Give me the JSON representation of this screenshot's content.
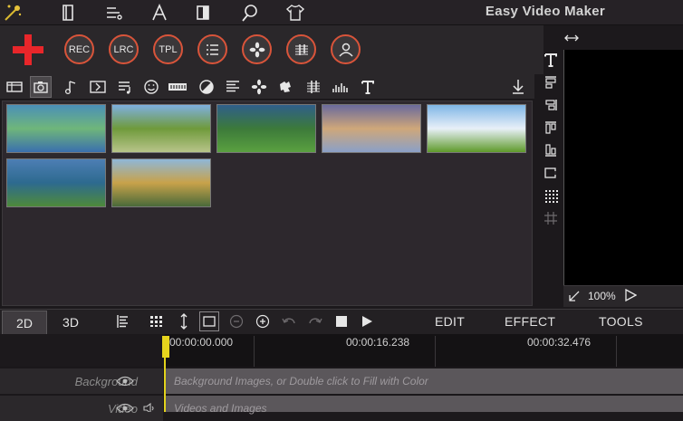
{
  "app": {
    "title": "Easy Video Maker"
  },
  "top_menu": {
    "icons": [
      "magic-wand-icon",
      "book-icon",
      "list-settings-icon",
      "text-tool-icon",
      "split-icon",
      "search-icon",
      "shirt-icon"
    ]
  },
  "toolbar": {
    "add_label": "+",
    "buttons": [
      {
        "id": "rec",
        "label": "REC"
      },
      {
        "id": "lrc",
        "label": "LRC"
      },
      {
        "id": "tpl",
        "label": "TPL"
      },
      {
        "id": "list",
        "label": ""
      },
      {
        "id": "effects",
        "label": ""
      },
      {
        "id": "music",
        "label": ""
      },
      {
        "id": "user",
        "label": ""
      }
    ]
  },
  "media": {
    "thumbnails": [
      {
        "name": "thumb-green-abstract",
        "colors": [
          "#4a8fb8",
          "#6fb67a",
          "#3a6fae"
        ]
      },
      {
        "name": "thumb-mountain-road",
        "colors": [
          "#7fb0e0",
          "#6f9a3b",
          "#b8c48a"
        ]
      },
      {
        "name": "thumb-valley",
        "colors": [
          "#2f5e8a",
          "#3c7a3a",
          "#5aa040"
        ]
      },
      {
        "name": "thumb-rainbow-beach",
        "colors": [
          "#6a6a9c",
          "#cfa77a",
          "#8aa0c8"
        ]
      },
      {
        "name": "thumb-meadow",
        "colors": [
          "#7fb6e6",
          "#e8f0f8",
          "#5f9a2a"
        ]
      },
      {
        "name": "thumb-lake",
        "colors": [
          "#4d7eb4",
          "#2d6a8f",
          "#4e8a3a"
        ]
      },
      {
        "name": "thumb-palace",
        "colors": [
          "#8fb7d8",
          "#c8a24a",
          "#4a6a3a"
        ]
      }
    ]
  },
  "preview": {
    "zoom": "100%"
  },
  "timeline": {
    "tabs": [
      {
        "label": "2D"
      },
      {
        "label": "3D"
      }
    ],
    "menus": {
      "edit": "EDIT",
      "effect": "EFFECT",
      "tools": "TOOLS"
    },
    "times": [
      "00:00:00.000",
      "00:00:16.238",
      "00:00:32.476"
    ],
    "tracks": [
      {
        "label": "Background",
        "hint": "Background Images, or Double click to Fill with Color"
      },
      {
        "label": "Video",
        "hint": "Videos and Images"
      }
    ]
  },
  "colors": {
    "accent": "#d9543a",
    "add": "#e8262a",
    "playhead": "#e2d21c"
  }
}
